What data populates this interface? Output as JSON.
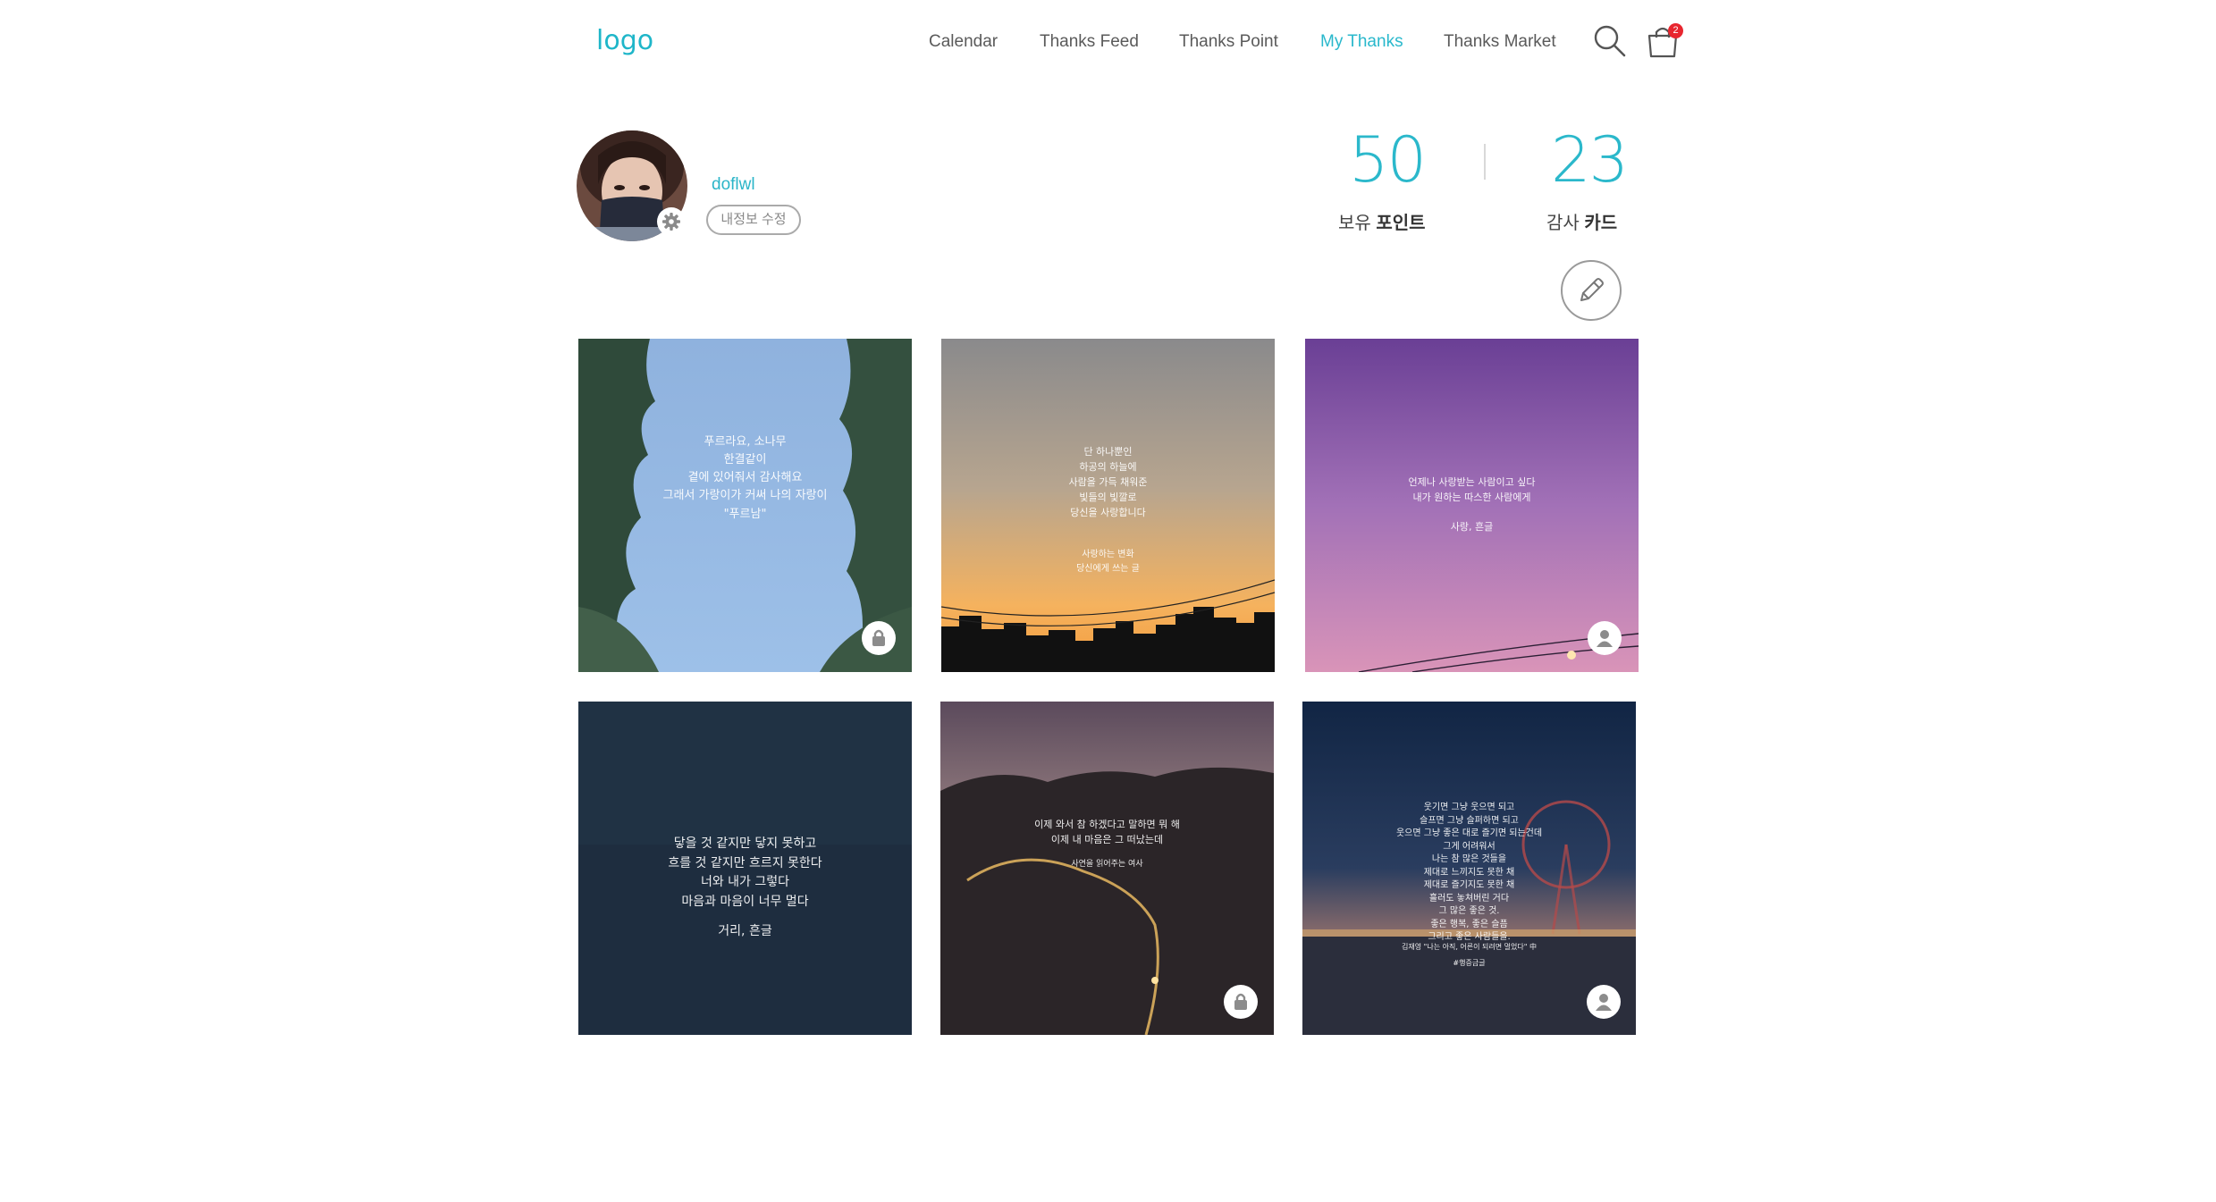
{
  "header": {
    "logo": "logo",
    "nav": [
      "Calendar",
      "Thanks Feed",
      "Thanks Point",
      "My Thanks",
      "Thanks Market"
    ],
    "active_nav": "My Thanks",
    "cart_count": "2"
  },
  "profile": {
    "username": "doflwl",
    "edit_label": "내정보 수정"
  },
  "stats": {
    "points_value": "50",
    "points_label_a": "보유",
    "points_label_b": "포인트",
    "cards_value": "23",
    "cards_label_a": "감사",
    "cards_label_b": "카드"
  },
  "cards": [
    {
      "text": "푸르라요, 소나무\n한결같이\n곁에 있어줘서 감사해요\n그래서 가랑이가 커써 나의 자랑이\n\"푸르남\"",
      "badge": "lock-icon"
    },
    {
      "text": "단 하나뿐인\n하공의 하늘에\n사람을 가득 채워준\n빛들의 빛깔로\n당신을 사랑합니다",
      "sub": "사랑하는 변화\n당신에게 쓰는 글",
      "badge": ""
    },
    {
      "text": "언제나 사랑받는 사람이고 싶다\n내가 원하는 따스한 사람에게",
      "sub": "사랑, 흔글",
      "badge": "user-icon"
    },
    {
      "text": "닿을 것 같지만 닿지 못하고\n흐를 것 같지만 흐르지 못한다\n너와 내가 그렇다\n마음과 마음이 너무 멀다",
      "sub": "거리, 흔글",
      "badge": ""
    },
    {
      "text": "이제 와서 참 하겠다고 말하면 뭐 해\n이제 내 마음은 그 떠났는데",
      "sub": "사연을 읽어주는 여사",
      "badge": "lock-icon"
    },
    {
      "text": "웃기면 그냥 웃으면 되고\n슬프면 그냥 슬퍼하면 되고\n웃으면 그냥 좋은 대로 즐기면 되는건데\n그게 어려워서\n나는 참 많은 것들을\n제대로 느끼지도 못한 채\n제대로 즐기지도 못한 채\n흘러도 놓쳐버린 거다\n그 많은 좋은 것.\n좋은 행복, 좋은 슬픔\n그리고 좋은 사람들을.",
      "sub": "김재영 \"나는 아직, 어른이 되려면 멀었다\" 中\n#행증금글",
      "badge": "user-icon"
    }
  ]
}
